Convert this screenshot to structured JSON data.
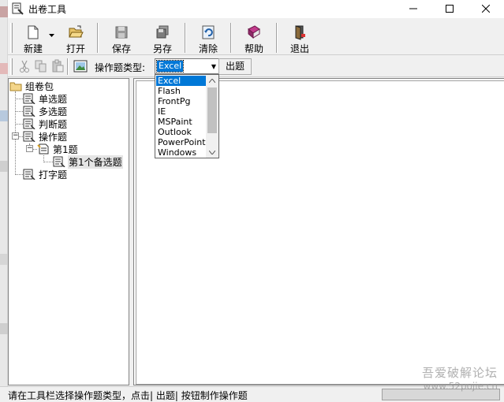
{
  "window": {
    "title": "出卷工具",
    "minimize_icon": "minimize-icon",
    "maximize_icon": "maximize-icon",
    "close_icon": "close-icon"
  },
  "toolbar": {
    "buttons": [
      {
        "label": "新建",
        "icon": "new-document-icon"
      },
      {
        "label": "打开",
        "icon": "open-folder-icon"
      },
      {
        "label": "保存",
        "icon": "save-disk-icon"
      },
      {
        "label": "另存",
        "icon": "save-as-icon"
      },
      {
        "label": "清除",
        "icon": "clear-icon"
      },
      {
        "label": "帮助",
        "icon": "help-book-icon"
      },
      {
        "label": "退出",
        "icon": "exit-door-icon"
      }
    ]
  },
  "toolbar2": {
    "type_label": "操作题类型:",
    "selected_type": "Excel",
    "generate_button": "出题"
  },
  "dropdown": {
    "options": [
      "Excel",
      "Flash",
      "FrontPg",
      "IE",
      "MSPaint",
      "Outlook",
      "PowerPoint",
      "Windows"
    ],
    "selected_index": 0
  },
  "tree": {
    "root": "组卷包",
    "nodes": [
      "单选题",
      "多选题",
      "判断题",
      "操作题",
      "第1题",
      "第1个备选题",
      "打字题"
    ]
  },
  "status": {
    "text": "请在工具栏选择操作题类型，点击| 出题| 按钮制作操作题"
  },
  "watermark": {
    "line1": "吾爱破解论坛",
    "line2": "www.52pojie.cn"
  },
  "colors": {
    "selection": "#0078d7",
    "window_bg": "#f0f0f0"
  }
}
